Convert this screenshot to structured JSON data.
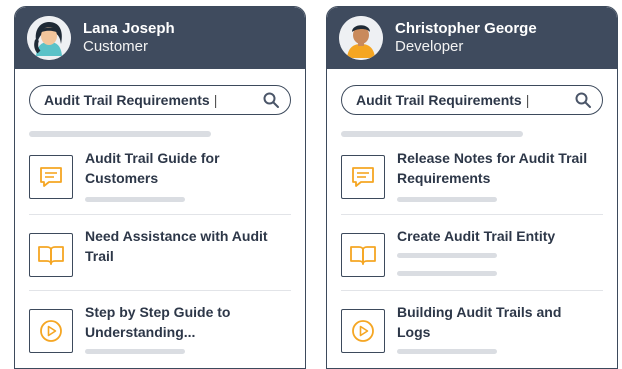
{
  "cards": [
    {
      "user": {
        "name": "Lana Joseph",
        "role": "Customer"
      },
      "search": {
        "value": "Audit Trail Requirements"
      },
      "items": [
        {
          "title": "Audit Trail Guide for Customers",
          "icon": "chat-icon"
        },
        {
          "title": "Need Assistance with Audit Trail",
          "icon": "book-icon"
        },
        {
          "title": "Step by Step Guide to Understanding...",
          "icon": "play-icon"
        }
      ]
    },
    {
      "user": {
        "name": "Christopher George",
        "role": "Developer"
      },
      "search": {
        "value": "Audit Trail Requirements"
      },
      "items": [
        {
          "title": "Release Notes for Audit Trail Requirements",
          "icon": "chat-icon"
        },
        {
          "title": "Create Audit Trail Entity",
          "icon": "book-icon"
        },
        {
          "title": "Building Audit Trails and Logs",
          "icon": "play-icon"
        }
      ]
    }
  ],
  "colors": {
    "header": "#3f4b5e",
    "accent": "#f5a623",
    "text": "#2d3748"
  }
}
